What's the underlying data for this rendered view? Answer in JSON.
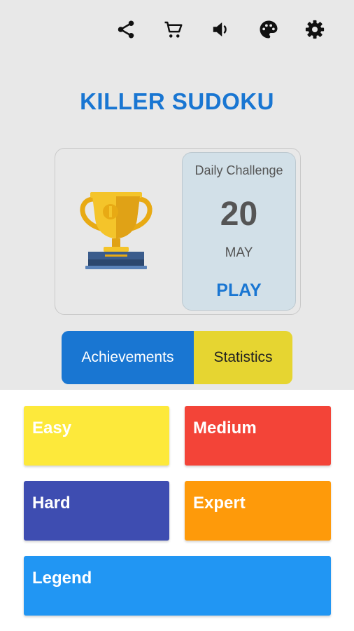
{
  "colors": {
    "top_background": "#e8e8e8",
    "title": "#1976d2",
    "daily_panel": "#d2e0e8",
    "achievements": "#1976d2",
    "statistics": "#e6d531",
    "easy": "#fde93b",
    "medium": "#f34438",
    "hard": "#3e4db1",
    "expert": "#fe9a0a",
    "legend": "#2196f3"
  },
  "toolbar": {
    "icons": [
      "share-icon",
      "cart-icon",
      "volume-icon",
      "palette-icon",
      "gear-icon"
    ]
  },
  "app": {
    "title": "KILLER SUDOKU"
  },
  "daily_challenge": {
    "label": "Daily Challenge",
    "day": "20",
    "month": "MAY",
    "play_label": "PLAY",
    "icon": "trophy-icon"
  },
  "tabs": {
    "achievements_label": "Achievements",
    "statistics_label": "Statistics"
  },
  "levels": {
    "easy": "Easy",
    "medium": "Medium",
    "hard": "Hard",
    "expert": "Expert",
    "legend": "Legend"
  }
}
